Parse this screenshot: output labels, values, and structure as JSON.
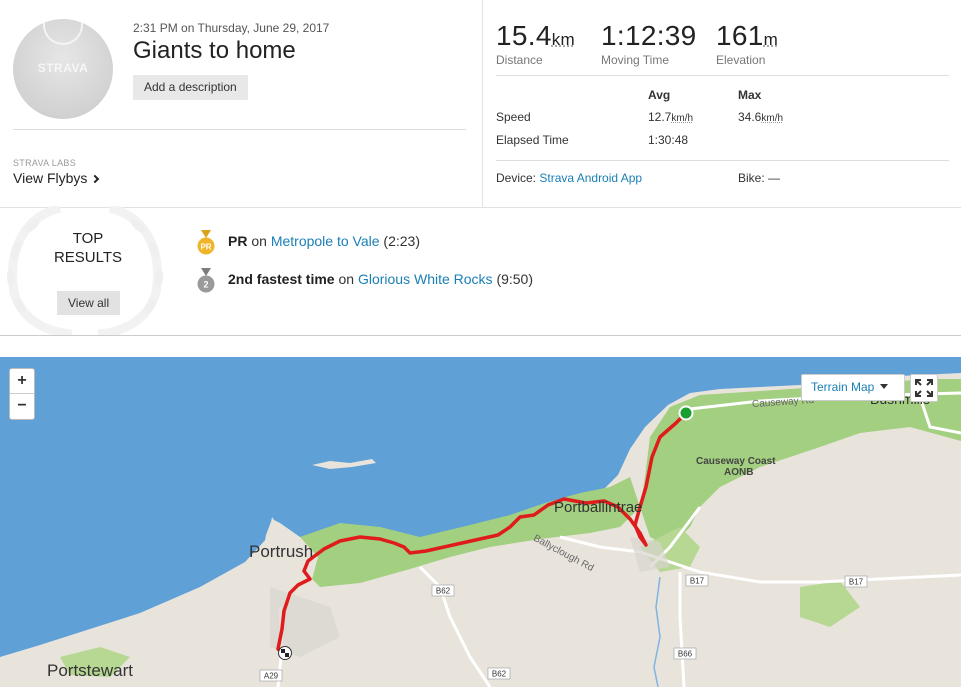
{
  "activity": {
    "date": "2:31 PM on Thursday, June 29, 2017",
    "title": "Giants to home",
    "description_button": "Add a description",
    "avatar_logo": "STRAVA"
  },
  "labs": {
    "label": "STRAVA LABS",
    "link": "View Flybys"
  },
  "stats": {
    "distance": {
      "value": "15.4",
      "unit": "km",
      "label": "Distance"
    },
    "moving_time": {
      "value": "1:12:39",
      "label": "Moving Time"
    },
    "elevation": {
      "value": "161",
      "unit": "m",
      "label": "Elevation"
    }
  },
  "table": {
    "col_avg": "Avg",
    "col_max": "Max",
    "speed_label": "Speed",
    "speed_avg": "12.7",
    "speed_max": "34.6",
    "speed_unit": "km/h",
    "elapsed_label": "Elapsed Time",
    "elapsed_avg": "1:30:48"
  },
  "device": {
    "label": "Device:",
    "value": "Strava Android App",
    "bike_label": "Bike:",
    "bike_value": "—"
  },
  "top_results": {
    "title_line1": "TOP",
    "title_line2": "RESULTS",
    "view_all": "View all",
    "items": [
      {
        "badge": "PR",
        "bold": "PR",
        "on": "on",
        "segment": "Metropole to Vale",
        "time": "(2:23)",
        "medal_color": "#f0b429"
      },
      {
        "badge": "2",
        "bold": "2nd fastest time",
        "on": "on",
        "segment": "Glorious White Rocks",
        "time": "(9:50)",
        "medal_color": "#9a9a9a"
      }
    ]
  },
  "map": {
    "zoom_in": "+",
    "zoom_out": "−",
    "layer_button": "Terrain Map",
    "labels": {
      "portrush": "Portrush",
      "portstewart": "Portstewart",
      "portballintrae": "Portballintrae",
      "causeway_coast": "Causeway Coast",
      "aonb": "AONB",
      "causeway_rd": "Causeway Rd",
      "ballyclough_rd": "Ballyclough Rd",
      "bushmills": "Bushmills",
      "b62a": "B62",
      "b62b": "B62",
      "b17a": "B17",
      "b17b": "B17",
      "b66": "B66",
      "a29": "A29"
    }
  },
  "colors": {
    "link": "#1a7fb5",
    "route": "#e01b1b",
    "start": "#1a9e2f",
    "sea": "#5fa0d6",
    "land": "#e8e4dc",
    "park": "#9ccc7a"
  }
}
